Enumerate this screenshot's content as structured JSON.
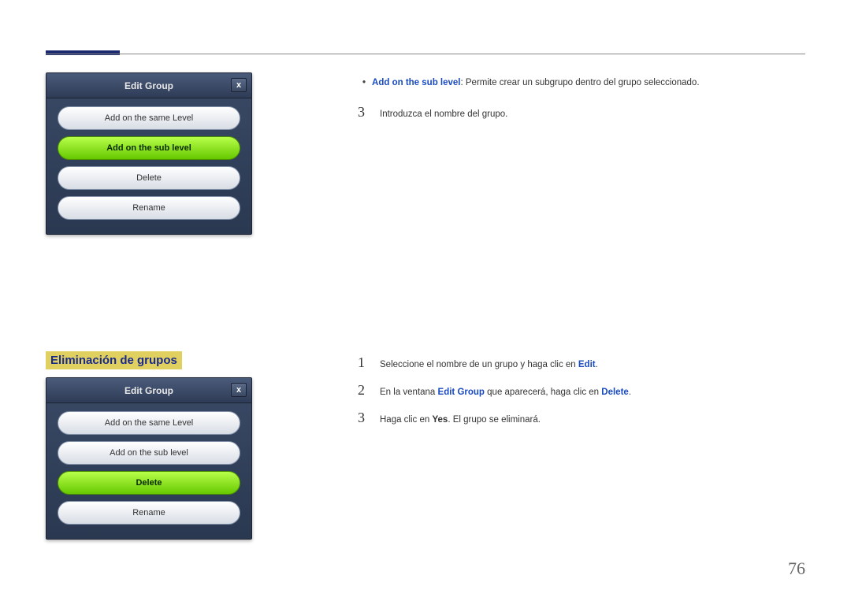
{
  "page_number": "76",
  "dialog1": {
    "title": "Edit Group",
    "close": "x",
    "buttons": {
      "same": "Add on the same Level",
      "sub": "Add on the sub level",
      "delete": "Delete",
      "rename": "Rename"
    }
  },
  "section_heading": "Eliminación de grupos",
  "dialog2": {
    "title": "Edit Group",
    "close": "x",
    "buttons": {
      "same": "Add on the same Level",
      "sub": "Add on the sub level",
      "delete": "Delete",
      "rename": "Rename"
    }
  },
  "top_bullet": {
    "label": "Add on the sub level",
    "text": ": Permite crear un subgrupo dentro del grupo seleccionado."
  },
  "top_step3": {
    "num": "3",
    "text": "Introduzca el nombre del grupo."
  },
  "steps": {
    "s1": {
      "num": "1",
      "pre": "Seleccione el nombre de un grupo y haga clic en ",
      "kw": "Edit",
      "post": "."
    },
    "s2": {
      "num": "2",
      "pre": "En la ventana ",
      "kw1": "Edit Group",
      "mid": " que aparecerá, haga clic en ",
      "kw2": "Delete",
      "post": "."
    },
    "s3": {
      "num": "3",
      "pre": "Haga clic en ",
      "kw": "Yes",
      "post": ". El grupo se eliminará."
    }
  }
}
